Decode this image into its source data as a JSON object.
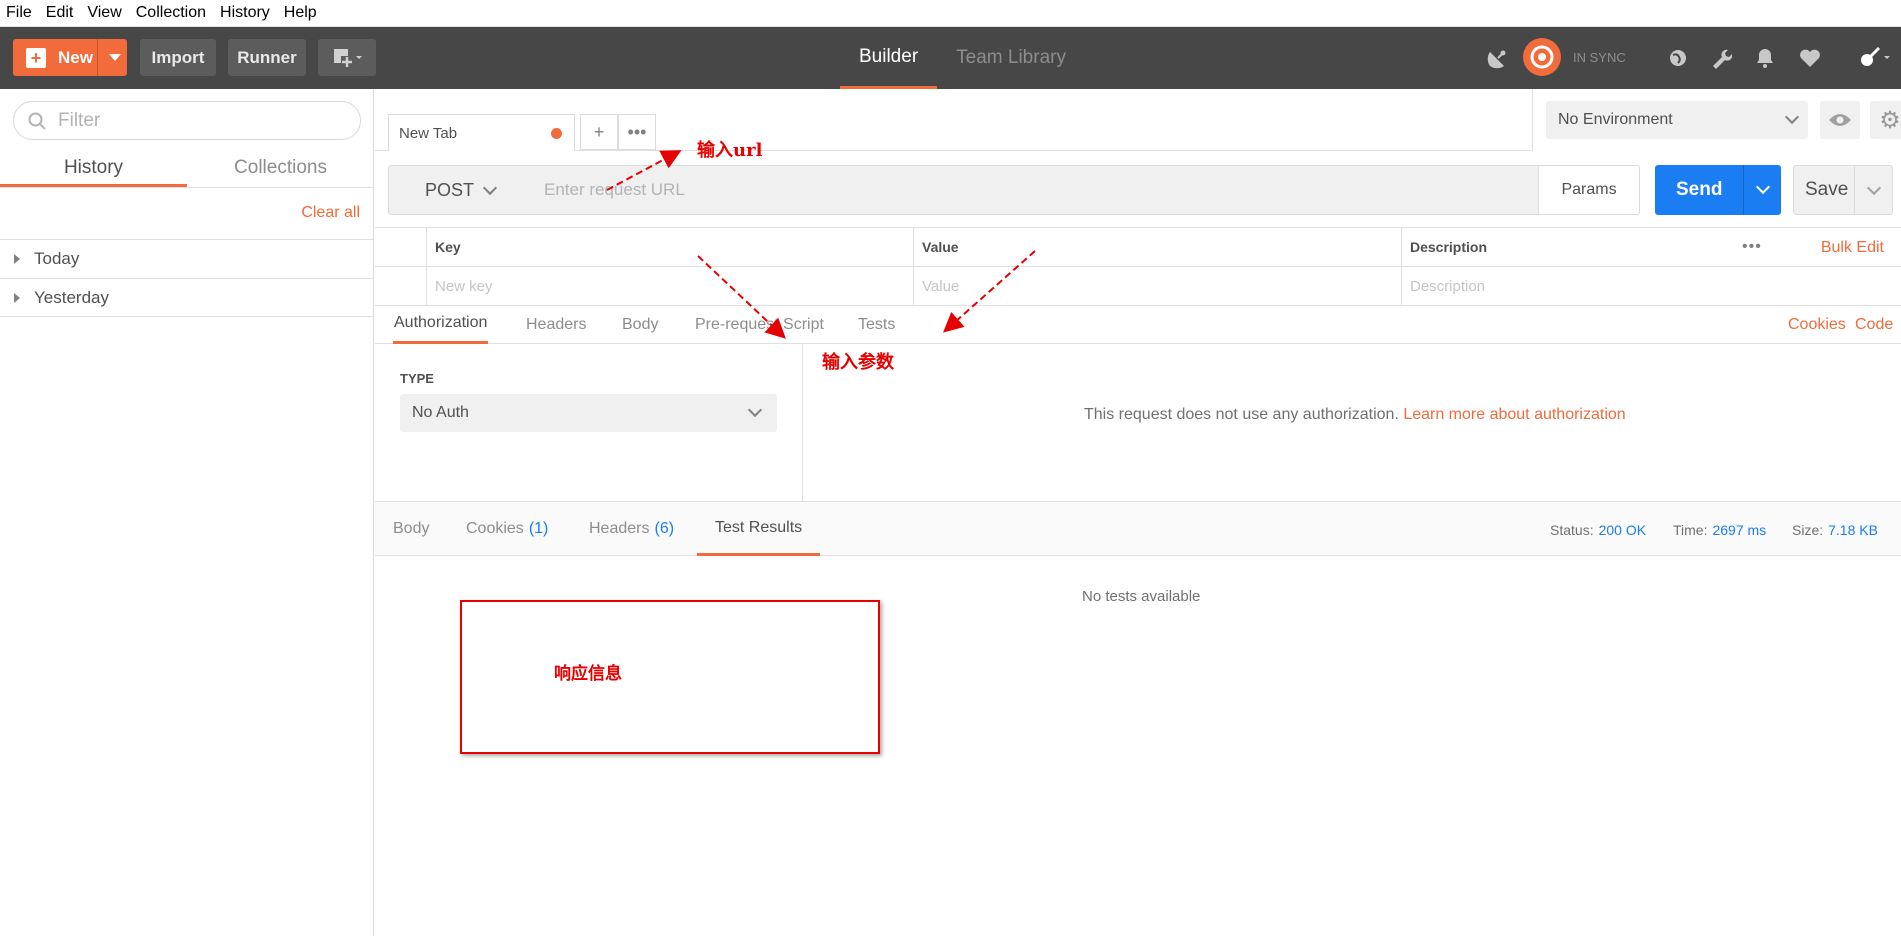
{
  "menu": [
    "File",
    "Edit",
    "View",
    "Collection",
    "History",
    "Help"
  ],
  "toolbar": {
    "new_label": "New",
    "import_label": "Import",
    "runner_label": "Runner",
    "tabs": [
      "Builder",
      "Team Library"
    ],
    "active_tab": "Builder",
    "sync_status": "IN SYNC"
  },
  "sidebar": {
    "filter_placeholder": "Filter",
    "tabs": [
      "History",
      "Collections"
    ],
    "active_tab": "History",
    "clear_all": "Clear all",
    "items": [
      "Today",
      "Yesterday"
    ]
  },
  "request": {
    "tab_name": "New Tab",
    "method": "POST",
    "url_placeholder": "Enter request URL",
    "params_label": "Params",
    "send_label": "Send",
    "save_label": "Save",
    "environment": "No Environment"
  },
  "params_table": {
    "headers": [
      "Key",
      "Value",
      "Description"
    ],
    "placeholders": [
      "New key",
      "Value",
      "Description"
    ],
    "bulk_edit": "Bulk Edit"
  },
  "request_tabs": {
    "items": [
      "Authorization",
      "Headers",
      "Body",
      "Pre-request Script",
      "Tests"
    ],
    "active": "Authorization",
    "links": [
      "Cookies",
      "Code"
    ]
  },
  "auth": {
    "type_label": "TYPE",
    "type_value": "No Auth",
    "message": "This request does not use any authorization.",
    "learn_more": "Learn more about authorization"
  },
  "response": {
    "tabs": [
      {
        "label": "Body",
        "count": ""
      },
      {
        "label": "Cookies",
        "count": "(1)"
      },
      {
        "label": "Headers",
        "count": "(6)"
      },
      {
        "label": "Test Results",
        "count": ""
      }
    ],
    "active": "Test Results",
    "status_label": "Status:",
    "status_value": "200 OK",
    "time_label": "Time:",
    "time_value": "2697 ms",
    "size_label": "Size:",
    "size_value": "7.18 KB",
    "empty_message": "No tests available"
  },
  "annotations": {
    "url_note": "输入url",
    "params_note": "输入参数",
    "response_note": "响应信息",
    "color": "#e60000"
  },
  "colors": {
    "accent": "#f26b3a",
    "send": "#1a7ef2",
    "toolbar_bg": "#474747"
  }
}
